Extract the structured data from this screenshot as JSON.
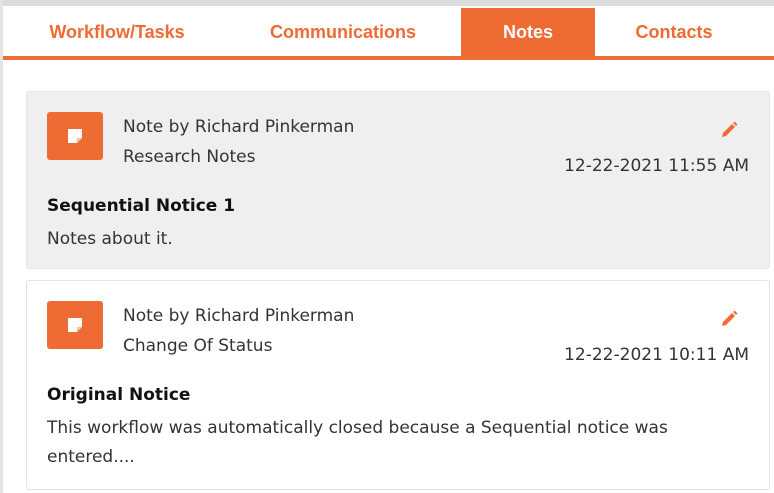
{
  "tabs": [
    {
      "label": "Workflow/Tasks",
      "active": false
    },
    {
      "label": "Communications",
      "active": false
    },
    {
      "label": "Notes",
      "active": true
    },
    {
      "label": "Contacts",
      "active": false
    }
  ],
  "notes": [
    {
      "author": "Note by Richard Pinkerman",
      "category": "Research Notes",
      "datetime": "12-22-2021 11:55 AM",
      "title": "Sequential Notice 1",
      "body": "Notes about it."
    },
    {
      "author": "Note by Richard Pinkerman",
      "category": "Change Of Status",
      "datetime": "12-22-2021 10:11 AM",
      "title": "Original Notice",
      "body": "This workflow was automatically closed because a Sequential notice was entered...."
    }
  ],
  "colors": {
    "accent": "#ee6b33",
    "card_shaded": "#efefef",
    "card_plain": "#ffffff"
  },
  "icons": {
    "note": "sticky-note-icon",
    "edit": "pencil-icon"
  }
}
